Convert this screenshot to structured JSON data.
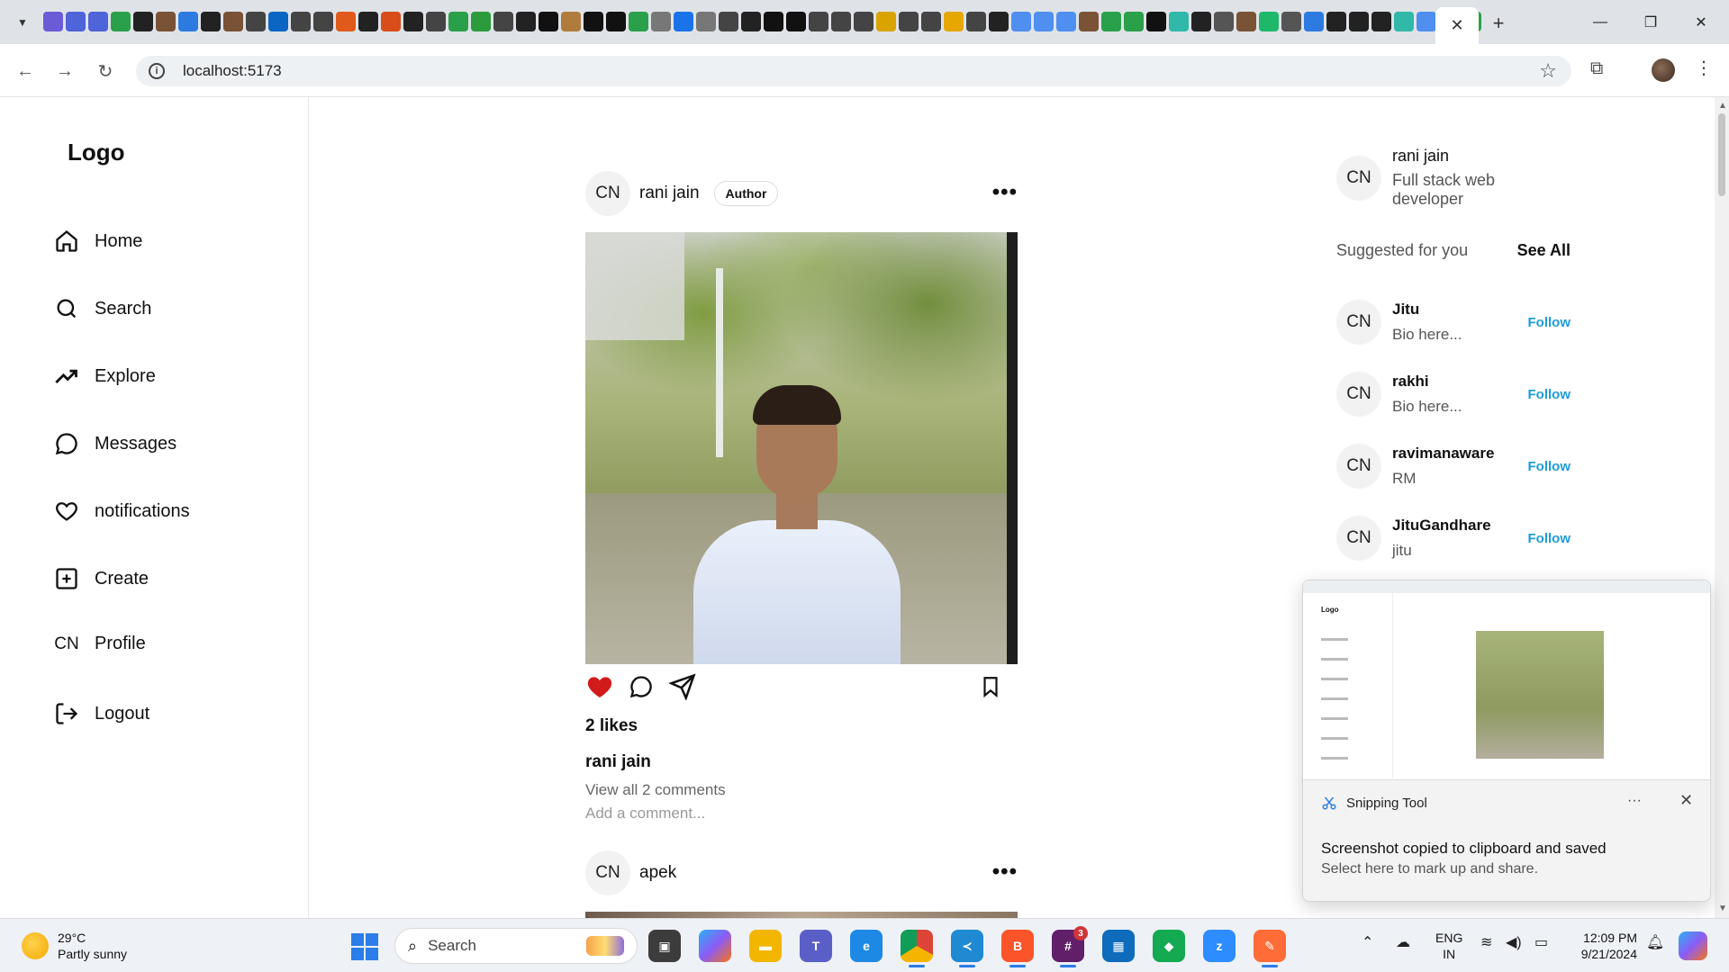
{
  "browser": {
    "tab_close": "✕",
    "new_tab": "+",
    "url": "localhost:5173",
    "favicon_colors": [
      "#6b5bd6",
      "#4e64d8",
      "#4e64d8",
      "#2aa04a",
      "#222",
      "#7a5236",
      "#2d7be0",
      "#222",
      "#7a5236",
      "#444",
      "#0a66c2",
      "#444",
      "#444",
      "#e05a1b",
      "#222",
      "#d94d1b",
      "#222",
      "#444",
      "#2aa04a",
      "#2b9b3c",
      "#444",
      "#222",
      "#111",
      "#b07c3d",
      "#111",
      "#111",
      "#2aa04a",
      "#777",
      "#1a73e8",
      "#777",
      "#444",
      "#222",
      "#111",
      "#111",
      "#444",
      "#444",
      "#444",
      "#d9a400",
      "#444",
      "#444",
      "#e6a700",
      "#444",
      "#222",
      "#4f8ff0",
      "#4f8ff0",
      "#4f8ff0",
      "#7a5236",
      "#2aa04a",
      "#2aa04a",
      "#111",
      "#30b8a8",
      "#222",
      "#555",
      "#7a5236",
      "#1fb86a",
      "#555",
      "#2d7be0",
      "#222",
      "#222",
      "#222",
      "#30b8a8",
      "#4f8ff0",
      "#d44",
      "#2aa04a"
    ]
  },
  "sidebar": {
    "logo": "Logo",
    "items": [
      {
        "label": "Home",
        "icon": "home-icon"
      },
      {
        "label": "Search",
        "icon": "search-icon"
      },
      {
        "label": "Explore",
        "icon": "trending-icon"
      },
      {
        "label": "Messages",
        "icon": "message-icon"
      },
      {
        "label": "notifications",
        "icon": "heart-icon"
      },
      {
        "label": "Create",
        "icon": "plus-square-icon"
      },
      {
        "label": "Profile",
        "icon": "CN"
      },
      {
        "label": "Logout",
        "icon": "logout-icon"
      }
    ]
  },
  "feed": {
    "posts": [
      {
        "avatar": "CN",
        "user": "rani jain",
        "badge": "Author",
        "menu": "•••",
        "likes": "2 likes",
        "caption_user": "rani jain",
        "view_comments": "View all 2 comments",
        "add_comment": "Add a comment...",
        "liked": true,
        "like_color": "#d11a1a"
      },
      {
        "avatar": "CN",
        "user": "apek",
        "menu": "•••"
      }
    ]
  },
  "right": {
    "me": {
      "avatar": "CN",
      "name": "rani jain",
      "bio": "Full stack web developer"
    },
    "suggested_title": "Suggested for you",
    "see_all": "See All",
    "suggestions": [
      {
        "avatar": "CN",
        "name": "Jitu",
        "bio": "Bio here...",
        "action": "Follow"
      },
      {
        "avatar": "CN",
        "name": "rakhi",
        "bio": "Bio here...",
        "action": "Follow"
      },
      {
        "avatar": "CN",
        "name": "ravimanaware",
        "bio": "RM",
        "action": "Follow"
      },
      {
        "avatar": "CN",
        "name": "JituGandhare",
        "bio": "jitu",
        "action": "Follow"
      }
    ],
    "follow_color": "#1e9bd8"
  },
  "toast": {
    "app": "Snipping Tool",
    "more": "···",
    "close": "✕",
    "title": "Screenshot copied to clipboard and saved",
    "subtitle": "Select here to mark up and share.",
    "thumb_logo": "Logo"
  },
  "taskbar": {
    "weather_temp": "29°C",
    "weather_desc": "Partly sunny",
    "search_label": "Search",
    "slack_badge": "3",
    "lang_1": "ENG",
    "lang_2": "IN",
    "time": "12:09 PM",
    "date": "9/21/2024"
  }
}
